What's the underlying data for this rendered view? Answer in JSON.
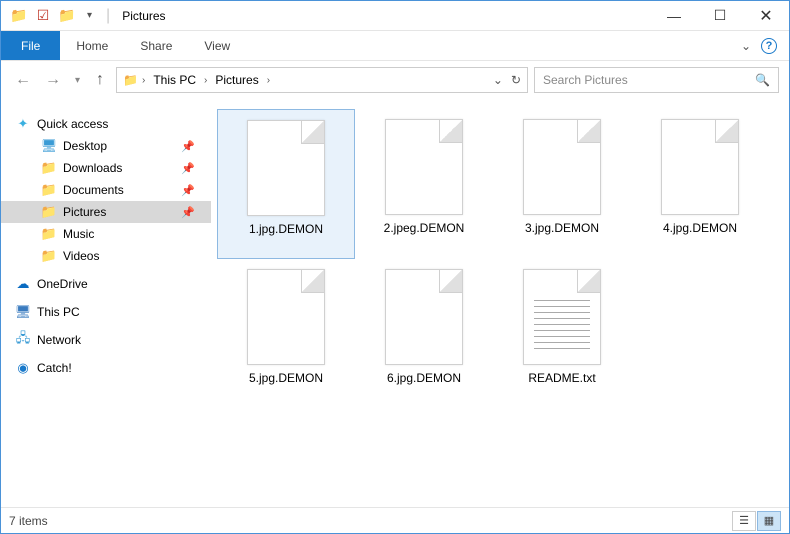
{
  "window": {
    "title": "Pictures"
  },
  "ribbon": {
    "file": "File",
    "tabs": [
      "Home",
      "Share",
      "View"
    ]
  },
  "address": {
    "segments": [
      "This PC",
      "Pictures"
    ]
  },
  "search": {
    "placeholder": "Search Pictures"
  },
  "sidebar": {
    "quick_access": "Quick access",
    "items": [
      {
        "label": "Desktop",
        "pinned": true
      },
      {
        "label": "Downloads",
        "pinned": true
      },
      {
        "label": "Documents",
        "pinned": true
      },
      {
        "label": "Pictures",
        "pinned": true,
        "selected": true
      },
      {
        "label": "Music",
        "pinned": false
      },
      {
        "label": "Videos",
        "pinned": false
      }
    ],
    "onedrive": "OneDrive",
    "thispc": "This PC",
    "network": "Network",
    "catch": "Catch!"
  },
  "files": [
    {
      "name": "1.jpg.DEMON",
      "type": "blank",
      "selected": true
    },
    {
      "name": "2.jpeg.DEMON",
      "type": "blank"
    },
    {
      "name": "3.jpg.DEMON",
      "type": "blank"
    },
    {
      "name": "4.jpg.DEMON",
      "type": "blank"
    },
    {
      "name": "5.jpg.DEMON",
      "type": "blank"
    },
    {
      "name": "6.jpg.DEMON",
      "type": "blank"
    },
    {
      "name": "README.txt",
      "type": "txt"
    }
  ],
  "status": {
    "count_label": "7 items"
  }
}
